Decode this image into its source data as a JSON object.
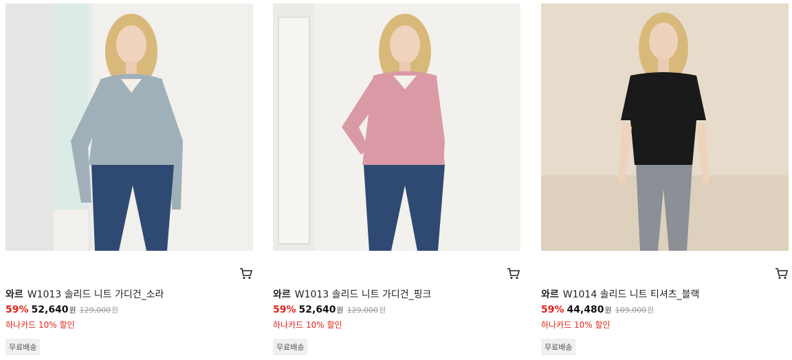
{
  "products": [
    {
      "brand": "와르",
      "name": "W1013 솔리드 니트 가디건_소라",
      "discount": "59%",
      "price": "52,640",
      "currency": "원",
      "original_price": "129,000",
      "promo": "하나카드 10% 할인",
      "badge": "무료배송",
      "image": {
        "top_color": "#9fb0b8",
        "bottom_color": "#2f4a72",
        "background": "#f1f0ec"
      }
    },
    {
      "brand": "와르",
      "name": "W1013 솔리드 니트 가디건_핑크",
      "discount": "59%",
      "price": "52,640",
      "currency": "원",
      "original_price": "129,000",
      "promo": "하나카드 10% 할인",
      "badge": "무료배송",
      "image": {
        "top_color": "#d99aa6",
        "bottom_color": "#2f4a72",
        "background": "#f3f1ed"
      }
    },
    {
      "brand": "와르",
      "name": "W1014 솔리드 니트 티셔츠_블랙",
      "discount": "59%",
      "price": "44,480",
      "currency": "원",
      "original_price": "109,000",
      "promo": "하나카드 10% 할인",
      "badge": "무료배송",
      "image": {
        "top_color": "#1a1a1a",
        "bottom_color": "#8b9097",
        "background": "#e7dccb"
      }
    }
  ],
  "icons": {
    "cart": "shopping-cart-icon"
  },
  "colors": {
    "discount": "#e2231a",
    "promo": "#e2231a",
    "badge_bg": "#f0f0f0"
  }
}
